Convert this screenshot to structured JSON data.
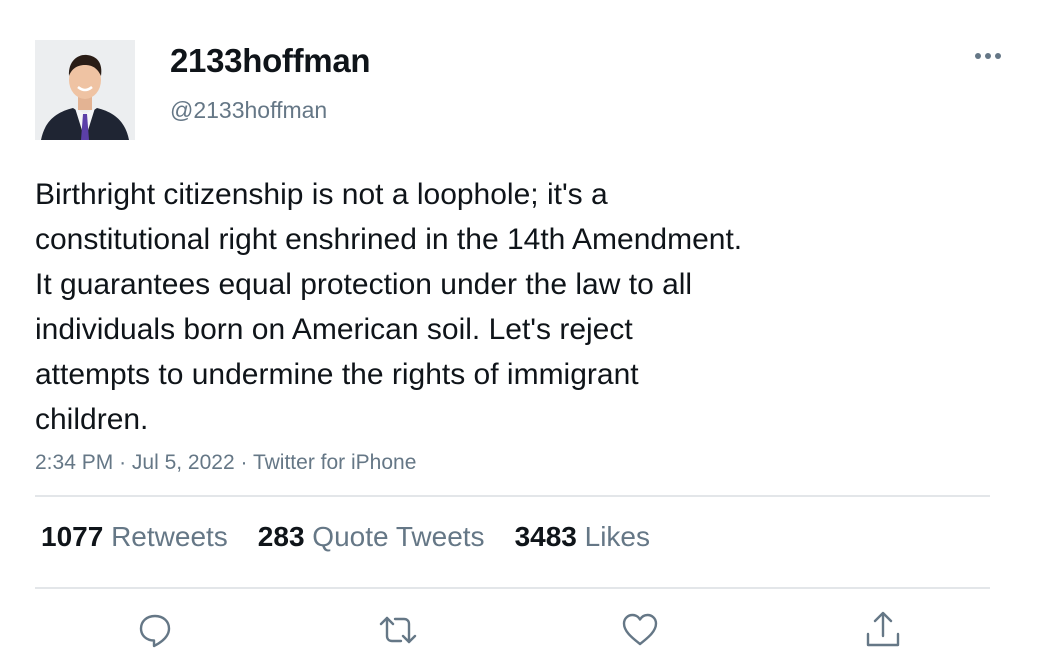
{
  "user": {
    "display_name": "2133hoffman",
    "handle": "@2133hoffman",
    "avatar_icon": "profile-photo"
  },
  "tweet": {
    "lines": [
      "Birthright citizenship is not a loophole; it's a",
      "constitutional right enshrined in the 14th Amendment.",
      "It guarantees equal protection under the law to all",
      "individuals born on American soil. Let's reject",
      "attempts to undermine the rights of immigrant",
      "children."
    ],
    "time": "2:34 PM",
    "separator": "·",
    "date": "Jul 5, 2022",
    "source": "Twitter for iPhone"
  },
  "stats": {
    "retweets_count": "1077",
    "retweets_label": "Retweets",
    "quotes_count": "283",
    "quotes_label": "Quote Tweets",
    "likes_count": "3483",
    "likes_label": "Likes"
  },
  "actions": {
    "reply_icon": "reply-icon",
    "retweet_icon": "retweet-icon",
    "like_icon": "heart-icon",
    "share_icon": "share-icon"
  },
  "colors": {
    "text_primary": "#0f1419",
    "text_secondary": "#657786",
    "divider": "#e3e6e9"
  }
}
